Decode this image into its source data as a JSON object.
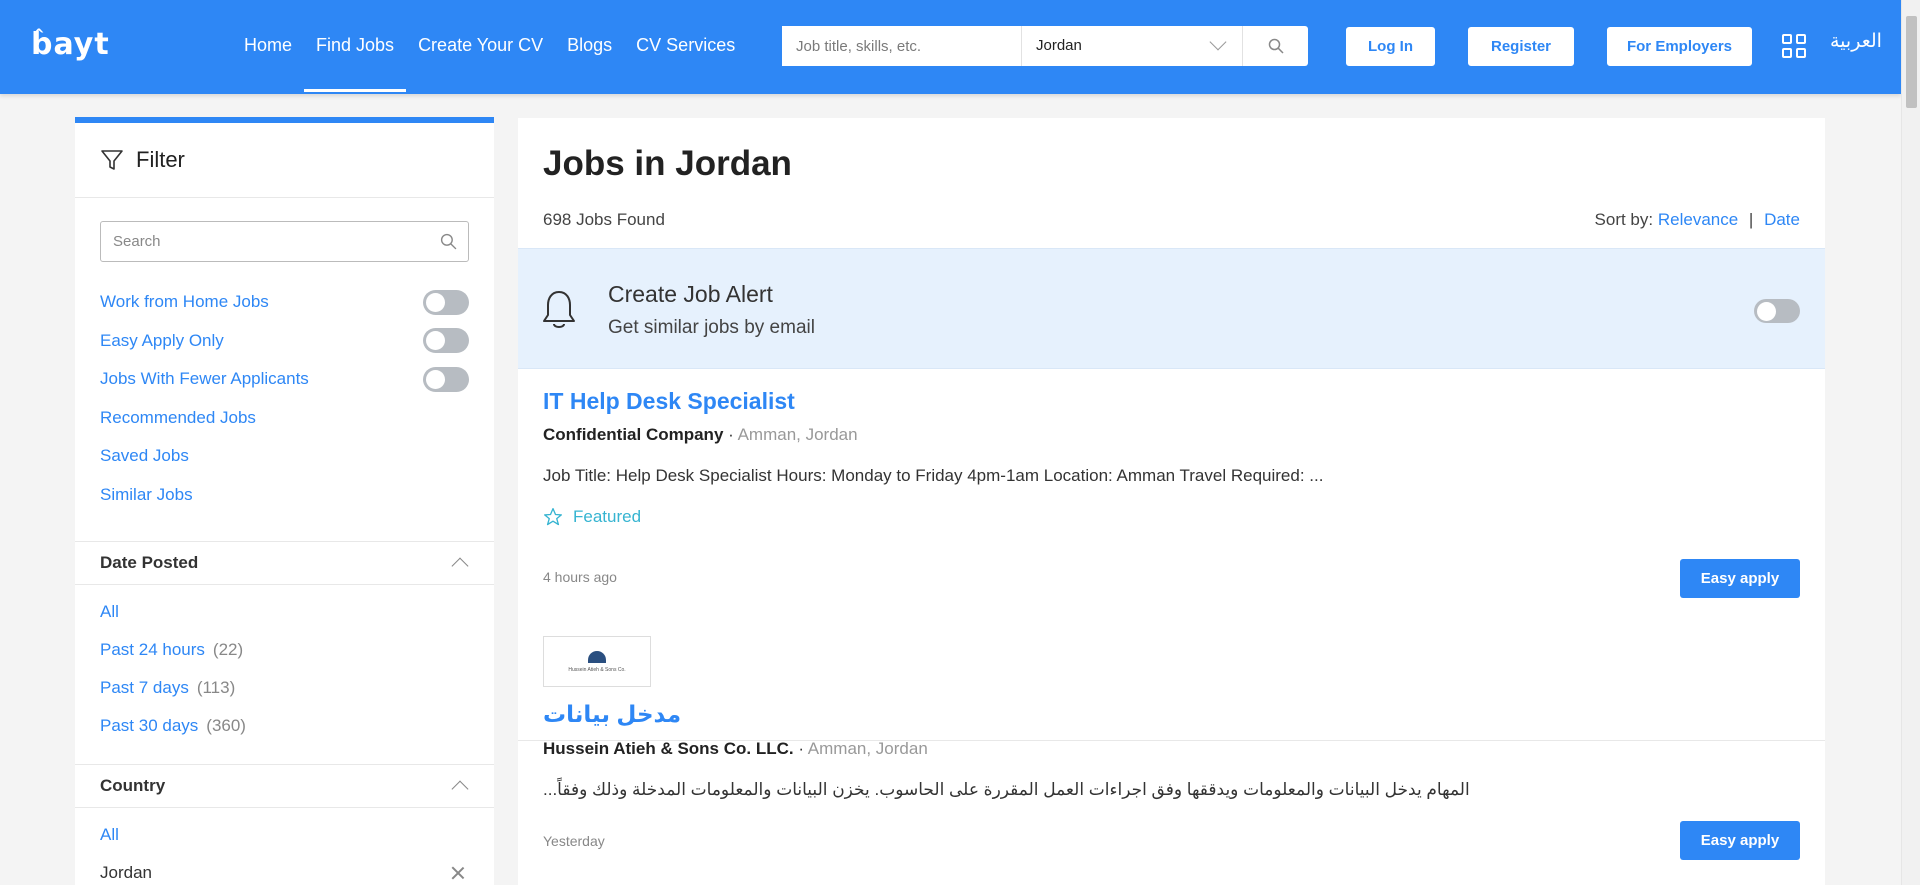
{
  "header": {
    "logo": "bayt",
    "nav": [
      {
        "label": "Home"
      },
      {
        "label": "Find Jobs"
      },
      {
        "label": "Create Your CV"
      },
      {
        "label": "Blogs"
      },
      {
        "label": "CV Services"
      }
    ],
    "search_placeholder": "Job title, skills, etc.",
    "location_value": "Jordan",
    "login_label": "Log In",
    "register_label": "Register",
    "employers_label": "For Employers",
    "language_label": "العربية",
    "brand_color": "#2e87f5"
  },
  "filter": {
    "title": "Filter",
    "search_placeholder": "Search",
    "quick": [
      {
        "label": "Work from Home Jobs"
      },
      {
        "label": "Easy Apply Only"
      },
      {
        "label": "Jobs With Fewer Applicants"
      },
      {
        "label": "Recommended Jobs"
      },
      {
        "label": "Saved Jobs"
      },
      {
        "label": "Similar Jobs"
      }
    ],
    "date_posted": {
      "title": "Date Posted",
      "options": [
        {
          "label": "All",
          "count": ""
        },
        {
          "label": "Past 24 hours",
          "count": "(22)"
        },
        {
          "label": "Past 7 days",
          "count": "(113)"
        },
        {
          "label": "Past 30 days",
          "count": "(360)"
        }
      ]
    },
    "country": {
      "title": "Country",
      "options": [
        {
          "label": "All"
        },
        {
          "label": "Jordan"
        }
      ]
    }
  },
  "main": {
    "title": "Jobs in Jordan",
    "found": "698 Jobs Found",
    "sort_label": "Sort by:",
    "sort_relevance": "Relevance",
    "sort_sep": "|",
    "sort_date": "Date",
    "alert_title": "Create Job Alert",
    "alert_sub": "Get similar jobs by email",
    "jobs": [
      {
        "title": "IT Help Desk Specialist",
        "company": "Confidential Company",
        "sep": " · ",
        "location": "Amman, Jordan",
        "desc": "Job Title: Help Desk Specialist Hours: Monday to Friday 4pm-1am Location: Amman Travel Required: ...",
        "featured": "Featured",
        "time": "4 hours ago",
        "apply": "Easy apply"
      },
      {
        "logo_text": "Hussein Atieh & Sons Co.",
        "title": "مدخل بيانات",
        "company": "Hussein Atieh & Sons Co. LLC.",
        "sep": " · ",
        "location": "Amman, Jordan",
        "desc": "المهام يدخل البيانات والمعلومات ويدققها وفق اجراءات العمل المقررة على الحاسوب. يخزن البيانات والمعلومات المدخلة وذلك وفقاً...",
        "time": "Yesterday",
        "apply": "Easy apply"
      }
    ]
  }
}
